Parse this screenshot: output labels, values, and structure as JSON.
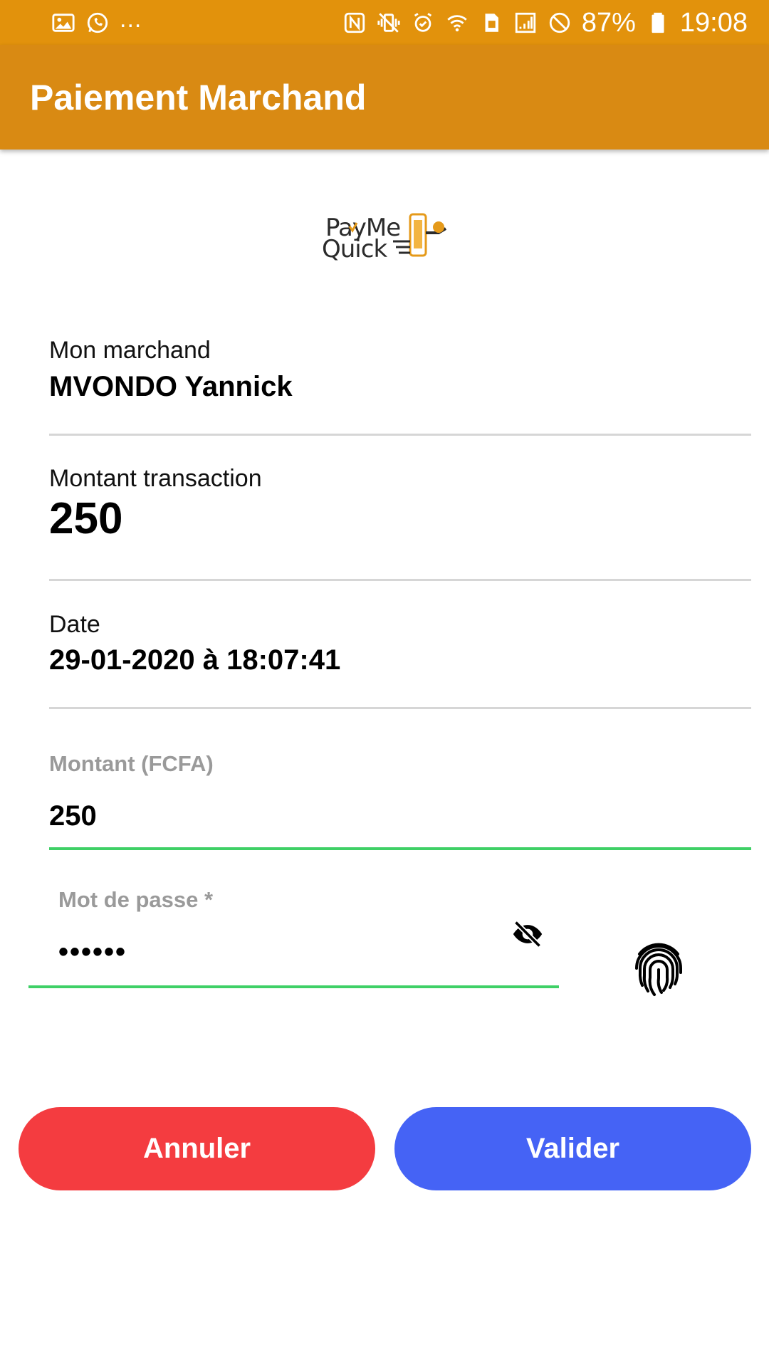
{
  "status_bar": {
    "overflow": "...",
    "battery": "87%",
    "time": "19:08",
    "left_icons": [
      "gallery-icon",
      "whatsapp-icon"
    ],
    "right_icons": [
      "nfc-icon",
      "vibrate-icon",
      "alarm-icon",
      "wifi-icon",
      "sim-icon",
      "signal-icon",
      "do-not-disturb-icon",
      "battery-icon"
    ]
  },
  "app_bar": {
    "title": "Paiement Marchand"
  },
  "logo": {
    "line1": "PayMe",
    "line2": "Quick"
  },
  "merchant": {
    "label": "Mon marchand",
    "value": "MVONDO Yannick"
  },
  "transaction": {
    "label": "Montant transaction",
    "value": "250"
  },
  "date": {
    "label": "Date",
    "value": "29-01-2020 à 18:07:41"
  },
  "amount_input": {
    "label": "Montant (FCFA)",
    "value": "250"
  },
  "password_input": {
    "label": "Mot de passe *",
    "value": "••••••"
  },
  "icons": {
    "visibility": "eye-off-icon",
    "fingerprint": "fingerprint-icon"
  },
  "buttons": {
    "cancel": "Annuler",
    "submit": "Valider"
  },
  "colors": {
    "status_bar": "#e2920c",
    "app_bar": "#d98a13",
    "accent_green": "#3fd066",
    "cancel": "#f43c40",
    "submit": "#4563f5"
  }
}
